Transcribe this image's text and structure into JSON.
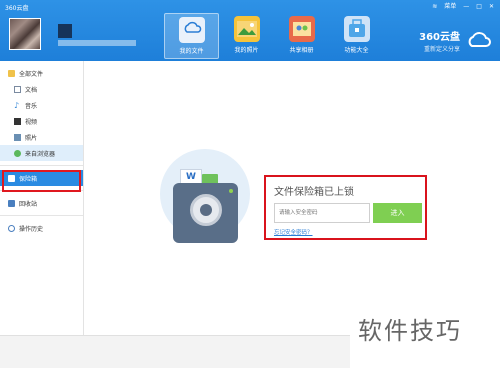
{
  "window": {
    "title": "360云盘",
    "controls": [
      "≋",
      "菜单",
      "—",
      "□",
      "✕"
    ]
  },
  "header": {
    "nav": [
      {
        "label": "我的文件",
        "icon": "cloud-files-icon",
        "active": true
      },
      {
        "label": "我的照片",
        "icon": "photo-icon",
        "active": false
      },
      {
        "label": "共享相册",
        "icon": "shared-album-icon",
        "active": false
      },
      {
        "label": "功能大全",
        "icon": "toolbox-icon",
        "active": false
      }
    ],
    "brand_name": "360云盘",
    "brand_slogan": "重新定义分享"
  },
  "sidebar": {
    "items": [
      {
        "label": "全部文件",
        "icon": "folder-icon",
        "level": 0
      },
      {
        "label": "文档",
        "icon": "document-icon",
        "level": 1
      },
      {
        "label": "音乐",
        "icon": "music-icon",
        "level": 1
      },
      {
        "label": "视频",
        "icon": "video-icon",
        "level": 1
      },
      {
        "label": "照片",
        "icon": "image-icon",
        "level": 1
      },
      {
        "label": "来自浏览器",
        "icon": "browser-icon",
        "level": 1
      },
      {
        "label": "保险箱",
        "icon": "safe-icon",
        "level": 0
      },
      {
        "label": "回收站",
        "icon": "trash-icon",
        "level": 0
      },
      {
        "label": "操作历史",
        "icon": "history-icon",
        "level": 0
      }
    ]
  },
  "vault": {
    "title": "文件保险箱已上锁",
    "password_placeholder": "请输入安全密码",
    "enter_label": "进入",
    "forgot_label": "忘记安全密码？"
  },
  "watermark": "软件技巧",
  "colors": {
    "header_blue": "#2e92e6",
    "selected_blue": "#2a8be2",
    "enter_green": "#7fcf52",
    "highlight_red": "#d9131c"
  }
}
